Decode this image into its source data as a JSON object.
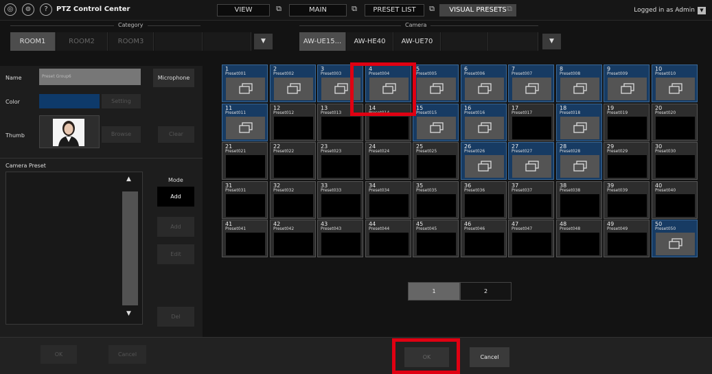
{
  "header": {
    "app_title": "PTZ Control Center",
    "tabs": [
      {
        "label": "VIEW",
        "active": false
      },
      {
        "label": "MAIN",
        "active": false
      },
      {
        "label": "PRESET LIST",
        "active": false
      },
      {
        "label": "VISUAL PRESETS",
        "active": true
      }
    ],
    "login_text": "Logged in as Admin"
  },
  "category": {
    "label": "Category",
    "tabs": [
      {
        "label": "ROOM1",
        "active": true
      },
      {
        "label": "ROOM2",
        "active": false
      },
      {
        "label": "ROOM3",
        "active": false
      }
    ],
    "dropdown_glyph": "▼"
  },
  "camera": {
    "label": "Camera",
    "tabs": [
      {
        "label": "AW-UE15...",
        "active": true
      },
      {
        "label": "AW-HE40",
        "active": false
      },
      {
        "label": "AW-UE70",
        "active": false
      }
    ],
    "dropdown_glyph": "▼"
  },
  "group_editor": {
    "name_label": "Name",
    "name_value": "Preset Group6",
    "microphone_label": "Microphone",
    "color_label": "Color",
    "color_value": "#0e3a6a",
    "setting_label": "Setting",
    "thumb_label": "Thumb",
    "browse_label": "Browse",
    "clear_label": "Clear",
    "camera_preset_label": "Camera Preset",
    "mode_label": "Mode",
    "mode_value": "Add",
    "add_label": "Add",
    "edit_label": "Edit",
    "del_label": "Del",
    "scroll_up": "▲",
    "scroll_down": "▼"
  },
  "presets": [
    {
      "num": "1",
      "name": "Preset001",
      "filled": true
    },
    {
      "num": "2",
      "name": "Preset002",
      "filled": true
    },
    {
      "num": "3",
      "name": "Preset003",
      "filled": true
    },
    {
      "num": "4",
      "name": "Preset004",
      "filled": true
    },
    {
      "num": "5",
      "name": "Preset005",
      "filled": true
    },
    {
      "num": "6",
      "name": "Preset006",
      "filled": true
    },
    {
      "num": "7",
      "name": "Preset007",
      "filled": true
    },
    {
      "num": "8",
      "name": "Preset008",
      "filled": true
    },
    {
      "num": "9",
      "name": "Preset009",
      "filled": true
    },
    {
      "num": "10",
      "name": "Preset010",
      "filled": true
    },
    {
      "num": "11",
      "name": "Preset011",
      "filled": true
    },
    {
      "num": "12",
      "name": "Preset012",
      "filled": false
    },
    {
      "num": "13",
      "name": "Preset013",
      "filled": false
    },
    {
      "num": "14",
      "name": "Preset014",
      "filled": false
    },
    {
      "num": "15",
      "name": "Preset015",
      "filled": true
    },
    {
      "num": "16",
      "name": "Preset016",
      "filled": true
    },
    {
      "num": "17",
      "name": "Preset017",
      "filled": false
    },
    {
      "num": "18",
      "name": "Preset018",
      "filled": true
    },
    {
      "num": "19",
      "name": "Preset019",
      "filled": false
    },
    {
      "num": "20",
      "name": "Preset020",
      "filled": false
    },
    {
      "num": "21",
      "name": "Preset021",
      "filled": false
    },
    {
      "num": "22",
      "name": "Preset022",
      "filled": false
    },
    {
      "num": "23",
      "name": "Preset023",
      "filled": false
    },
    {
      "num": "24",
      "name": "Preset024",
      "filled": false
    },
    {
      "num": "25",
      "name": "Preset025",
      "filled": false
    },
    {
      "num": "26",
      "name": "Preset026",
      "filled": true
    },
    {
      "num": "27",
      "name": "Preset027",
      "filled": true
    },
    {
      "num": "28",
      "name": "Preset028",
      "filled": true
    },
    {
      "num": "29",
      "name": "Preset029",
      "filled": false
    },
    {
      "num": "30",
      "name": "Preset030",
      "filled": false
    },
    {
      "num": "31",
      "name": "Preset031",
      "filled": false
    },
    {
      "num": "32",
      "name": "Preset032",
      "filled": false
    },
    {
      "num": "33",
      "name": "Preset033",
      "filled": false
    },
    {
      "num": "34",
      "name": "Preset034",
      "filled": false
    },
    {
      "num": "35",
      "name": "Preset035",
      "filled": false
    },
    {
      "num": "36",
      "name": "Preset036",
      "filled": false
    },
    {
      "num": "37",
      "name": "Preset037",
      "filled": false
    },
    {
      "num": "38",
      "name": "Preset038",
      "filled": false
    },
    {
      "num": "39",
      "name": "Preset039",
      "filled": false
    },
    {
      "num": "40",
      "name": "Preset040",
      "filled": false
    },
    {
      "num": "41",
      "name": "Preset041",
      "filled": false
    },
    {
      "num": "42",
      "name": "Preset042",
      "filled": false
    },
    {
      "num": "43",
      "name": "Preset043",
      "filled": false
    },
    {
      "num": "44",
      "name": "Preset044",
      "filled": false
    },
    {
      "num": "45",
      "name": "Preset045",
      "filled": false
    },
    {
      "num": "46",
      "name": "Preset046",
      "filled": false
    },
    {
      "num": "47",
      "name": "Preset047",
      "filled": false
    },
    {
      "num": "48",
      "name": "Preset048",
      "filled": false
    },
    {
      "num": "49",
      "name": "Preset049",
      "filled": false
    },
    {
      "num": "50",
      "name": "Preset050",
      "filled": true
    }
  ],
  "pagination": {
    "pages": [
      "1",
      "2"
    ],
    "current": "1"
  },
  "footer": {
    "ok_label": "OK",
    "cancel_label": "Cancel"
  },
  "colors": {
    "accent_blue": "#173b63",
    "highlight_red": "#e00012"
  }
}
